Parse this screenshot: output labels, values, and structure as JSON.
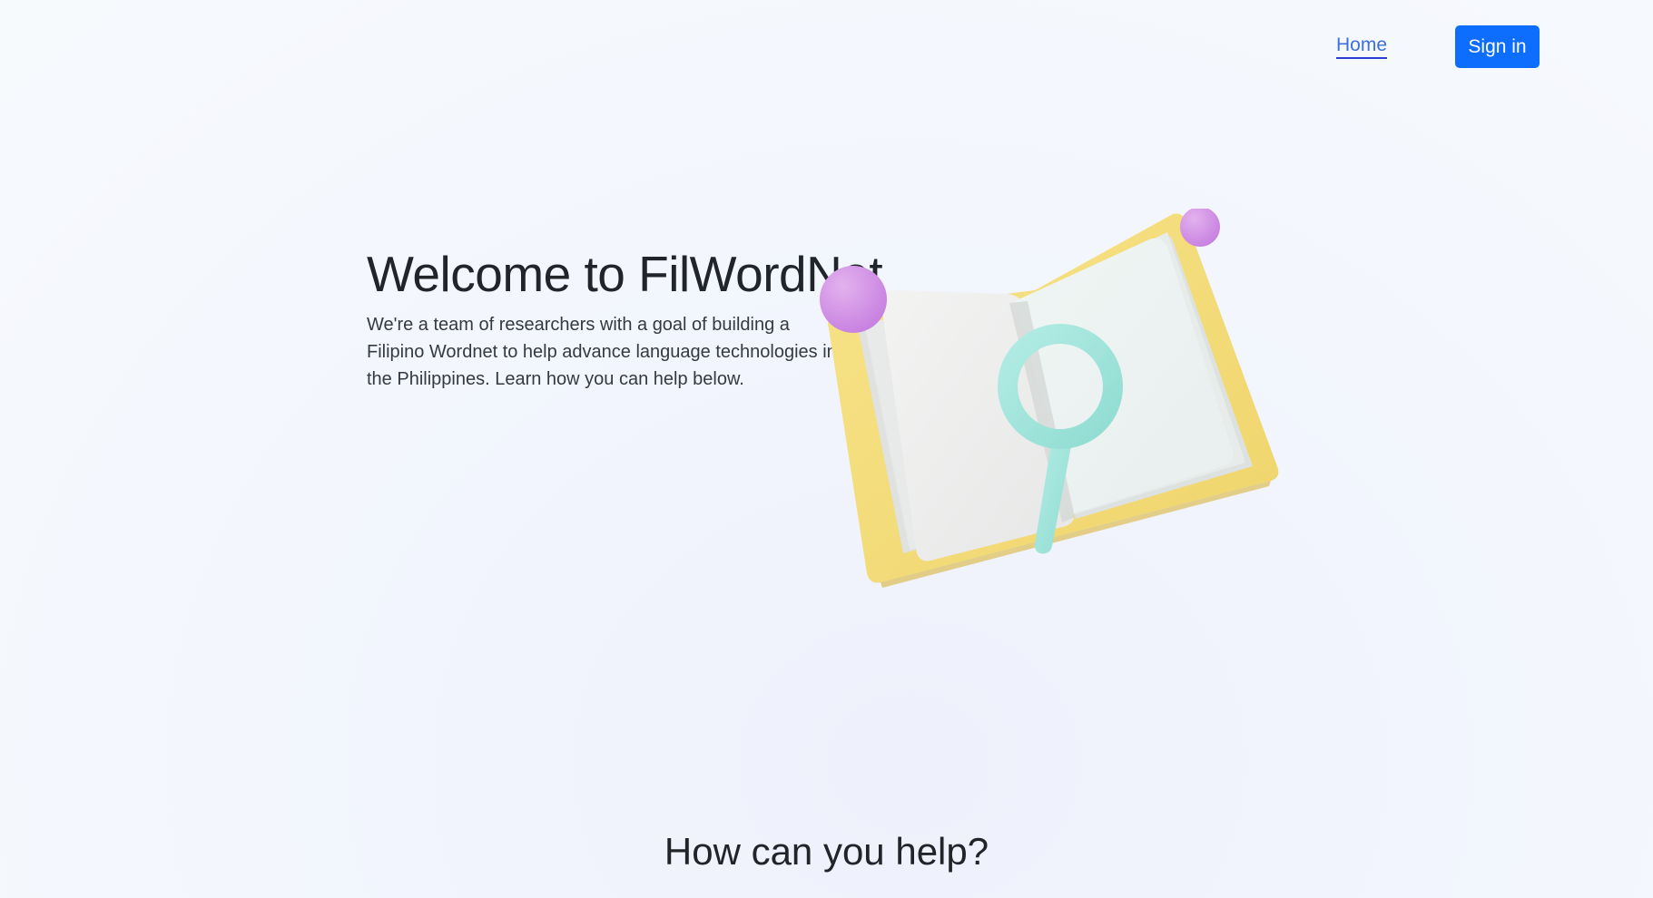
{
  "nav": {
    "home_label": "Home",
    "signin_label": "Sign in",
    "accent_color": "#0d6efd"
  },
  "hero": {
    "title": "Welcome to FilWordNet",
    "description": "We're a team of researchers with a goal of building a Filipino Wordnet to help advance language technologies in the Philippines. Learn how you can help below.",
    "illustration": "open-book-with-magnifier-illustration"
  },
  "help_section": {
    "title": "How can you help?"
  }
}
